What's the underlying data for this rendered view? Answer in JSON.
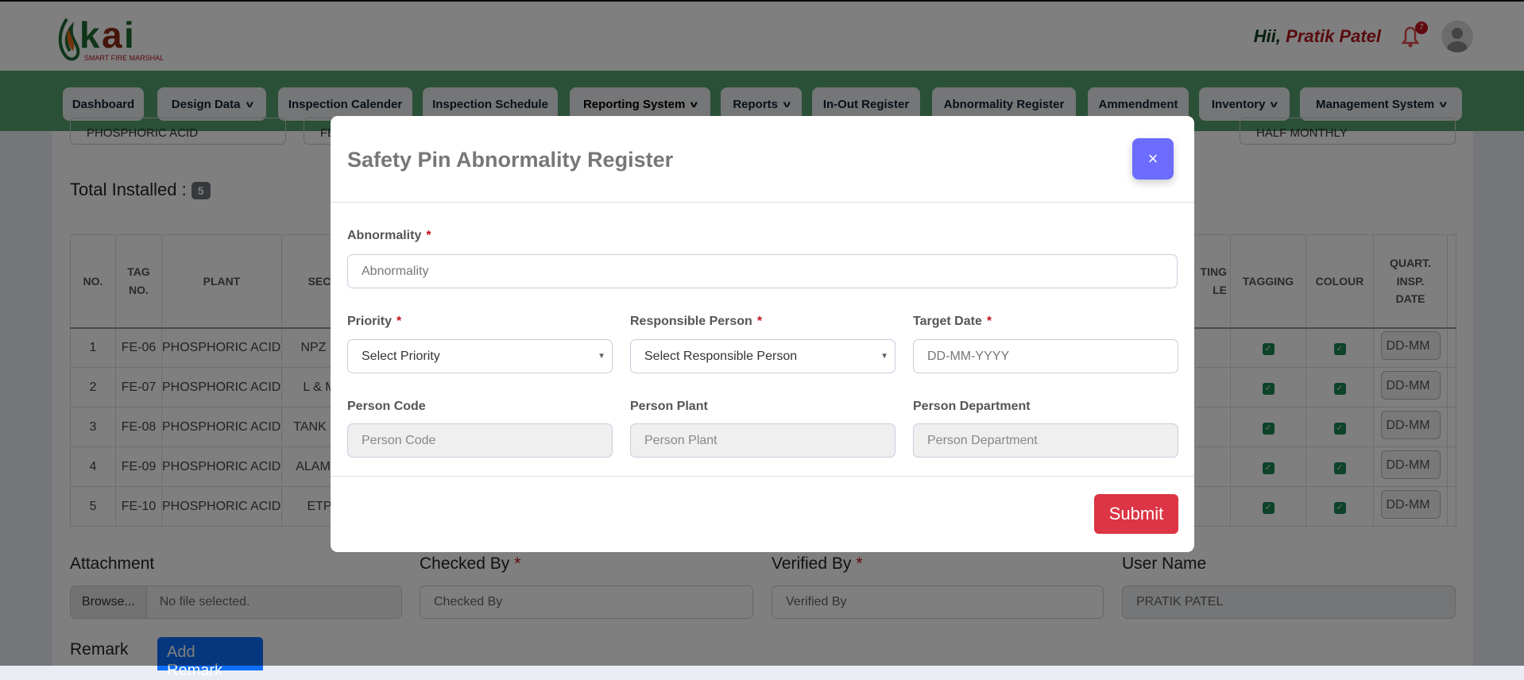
{
  "header": {
    "logo_text": "kai",
    "logo_tagline": "SMART FIRE MARSHAL",
    "greeting": "Hii,",
    "user": "Pratik Patel",
    "notification_count": "7"
  },
  "nav": [
    {
      "label": "Dashboard",
      "dropdown": false
    },
    {
      "label": "Design Data",
      "dropdown": true
    },
    {
      "label": "Inspection Calender",
      "dropdown": false
    },
    {
      "label": "Inspection Schedule",
      "dropdown": false
    },
    {
      "label": "Reporting System",
      "dropdown": true
    },
    {
      "label": "Reports",
      "dropdown": true
    },
    {
      "label": "In-Out Register",
      "dropdown": false
    },
    {
      "label": "Abnormality Register",
      "dropdown": false
    },
    {
      "label": "Ammendment",
      "dropdown": false
    },
    {
      "label": "Inventory",
      "dropdown": true
    },
    {
      "label": "Management System",
      "dropdown": true
    }
  ],
  "filters": {
    "plant": "PHOSPHORIC ACID",
    "second": "FE",
    "frequency": "HALF MONTHLY"
  },
  "total": {
    "label": "Total Installed :",
    "count": "5"
  },
  "table": {
    "headers": {
      "no": "NO.",
      "tag1": "TAG",
      "tag2": "NO.",
      "plant": "PLANT",
      "section": "SEC",
      "mount1": "TING",
      "mount2": "LE",
      "tagging": "TAGGING",
      "colour": "COLOUR",
      "q1": "QUART.",
      "q2": "INSP.",
      "q3": "DATE"
    },
    "rows": [
      {
        "no": "1",
        "tag": "FE-06",
        "plant": "PHOSPHORIC ACID",
        "section": "NPZ S",
        "tagging": true,
        "colour": true,
        "date": "DD-MM"
      },
      {
        "no": "2",
        "tag": "FE-07",
        "plant": "PHOSPHORIC ACID",
        "section": "L & M",
        "tagging": true,
        "colour": true,
        "date": "DD-MM"
      },
      {
        "no": "3",
        "tag": "FE-08",
        "plant": "PHOSPHORIC ACID",
        "section": "TANK FA",
        "tagging": true,
        "colour": true,
        "date": "DD-MM"
      },
      {
        "no": "4",
        "tag": "FE-09",
        "plant": "PHOSPHORIC ACID",
        "section": "ALAMIN",
        "tagging": true,
        "colour": true,
        "date": "DD-MM"
      },
      {
        "no": "5",
        "tag": "FE-10",
        "plant": "PHOSPHORIC ACID",
        "section": "ETP",
        "tagging": true,
        "colour": true,
        "date": "DD-MM"
      }
    ]
  },
  "bottom": {
    "attachment_label": "Attachment",
    "browse": "Browse...",
    "no_file": "No file selected.",
    "checked_by_label": "Checked By",
    "checked_by_placeholder": "Checked By",
    "verified_by_label": "Verified By",
    "verified_by_placeholder": "Verified By",
    "user_name_label": "User Name",
    "user_name_value": "PRATIK PATEL",
    "remark_label": "Remark",
    "add_remark": "Add Remark"
  },
  "modal": {
    "title": "Safety Pin Abnormality Register",
    "close": "×",
    "abnormality_label": "Abnormality",
    "abnormality_placeholder": "Abnormality",
    "priority_label": "Priority",
    "priority_value": "Select Priority",
    "responsible_label": "Responsible Person",
    "responsible_value": "Select Responsible Person",
    "target_label": "Target Date",
    "target_placeholder": "DD-MM-YYYY",
    "code_label": "Person Code",
    "code_placeholder": "Person Code",
    "plant_label": "Person Plant",
    "plant_placeholder": "Person Plant",
    "dept_label": "Person Department",
    "dept_placeholder": "Person Department",
    "submit": "Submit"
  },
  "colors": {
    "nav_green": "#54a070",
    "submit_red": "#dc3545",
    "close_blue": "#6c6cff",
    "checkbox_green": "#198754",
    "primary": "#0d6efd"
  }
}
